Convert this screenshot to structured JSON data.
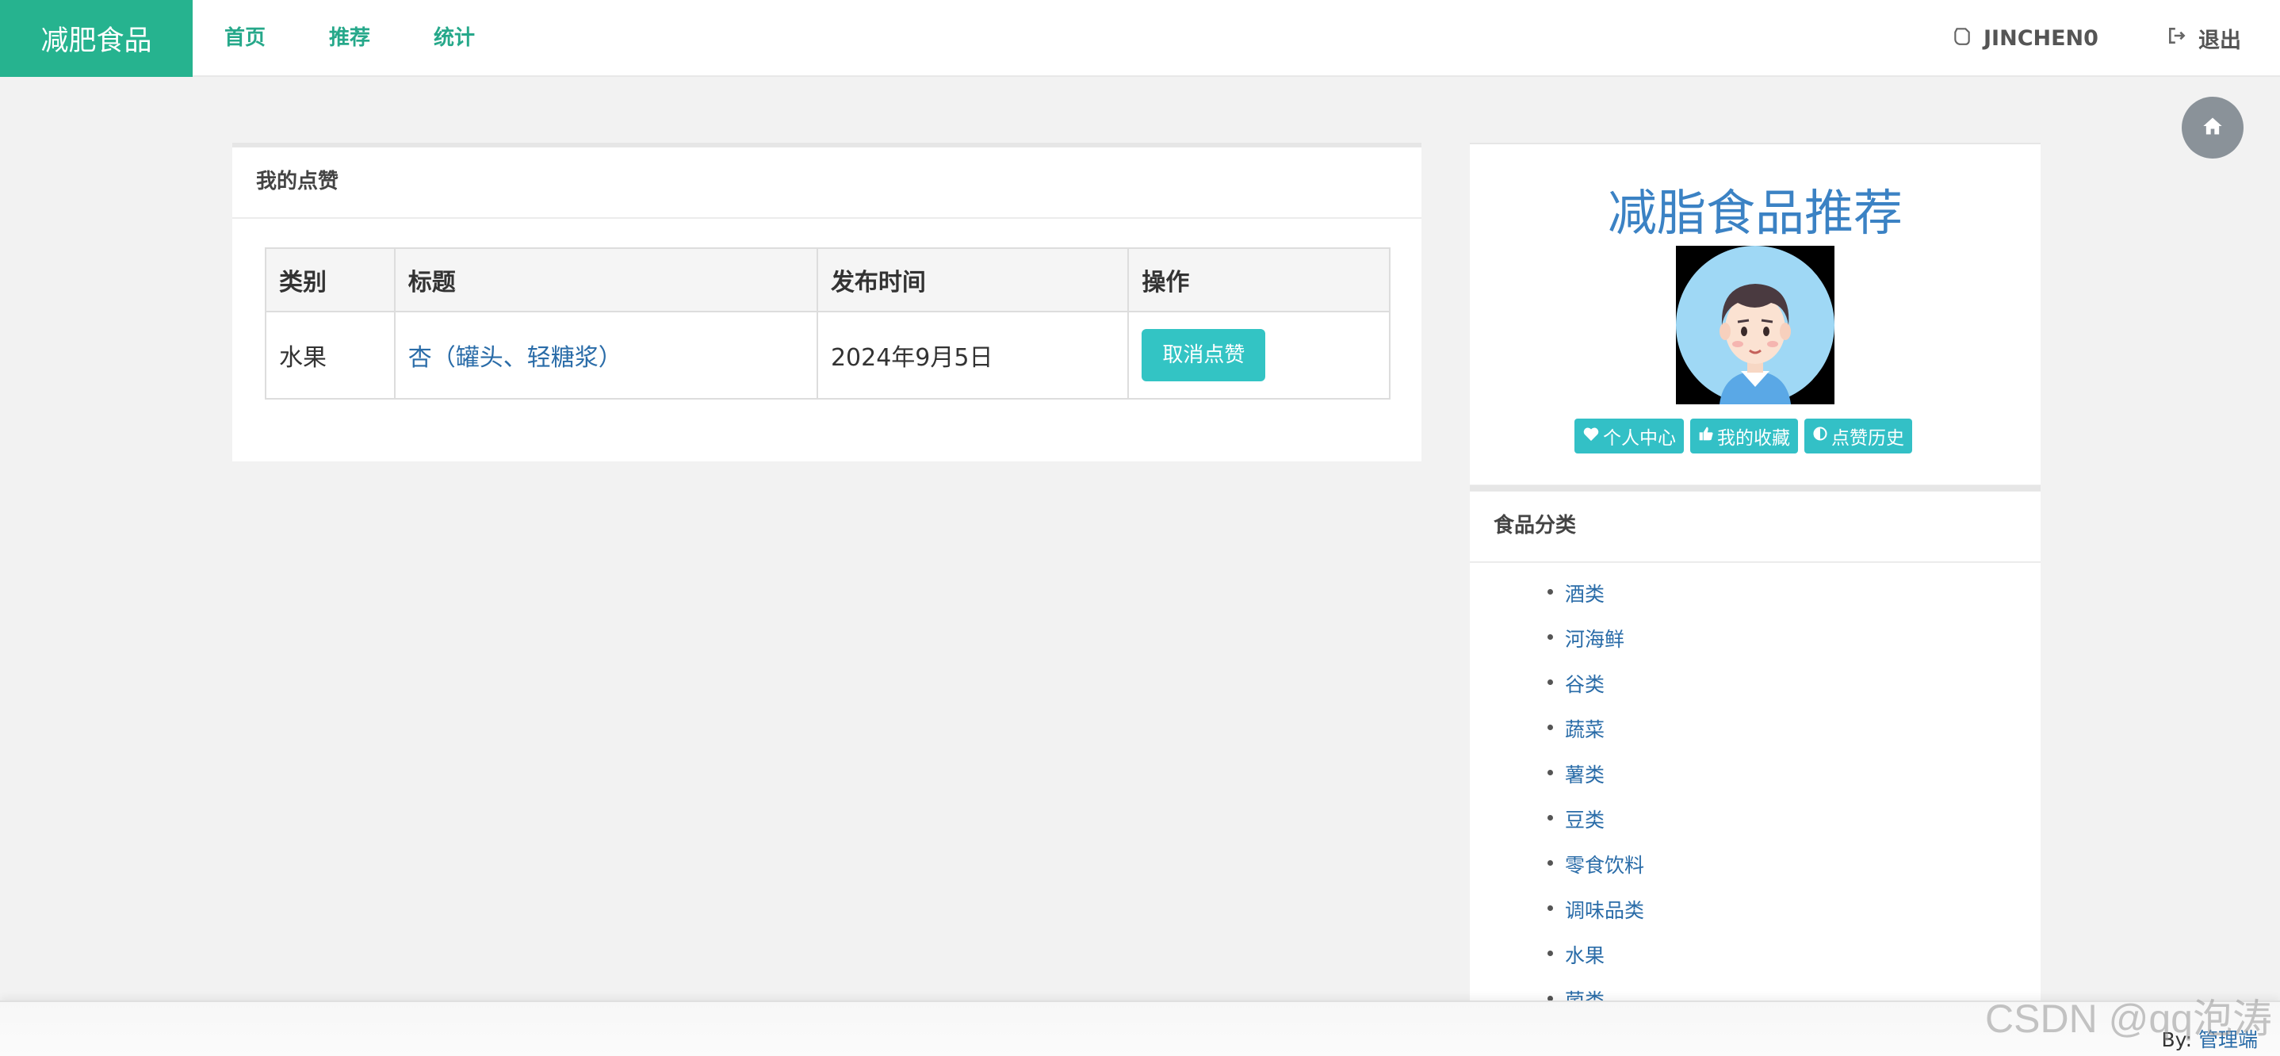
{
  "navbar": {
    "brand": "减肥食品",
    "links": [
      "首页",
      "推荐",
      "统计"
    ],
    "username": "JINCHEN0",
    "logout": "退出"
  },
  "likes_panel": {
    "title": "我的点赞",
    "columns": [
      "类别",
      "标题",
      "发布时间",
      "操作"
    ],
    "rows": [
      {
        "category": "水果",
        "title": "杏（罐头、轻糖浆）",
        "date": "2024年9月5日",
        "action": "取消点赞"
      }
    ]
  },
  "sidebar": {
    "heading": "减脂食品推荐",
    "tags": [
      "个人中心",
      "我的收藏",
      "点赞历史"
    ],
    "category_title": "食品分类",
    "categories": [
      "酒类",
      "河海鲜",
      "谷类",
      "蔬菜",
      "薯类",
      "豆类",
      "零食饮料",
      "调味品类",
      "水果",
      "菌类"
    ]
  },
  "footer": {
    "by_label": "By:",
    "admin_link": "管理端"
  },
  "watermark": "CSDN @qq泡涛",
  "colors": {
    "brand": "#26b38f",
    "accent": "#33c4c4",
    "link": "#2a6ca8",
    "heading": "#3b82c4"
  }
}
